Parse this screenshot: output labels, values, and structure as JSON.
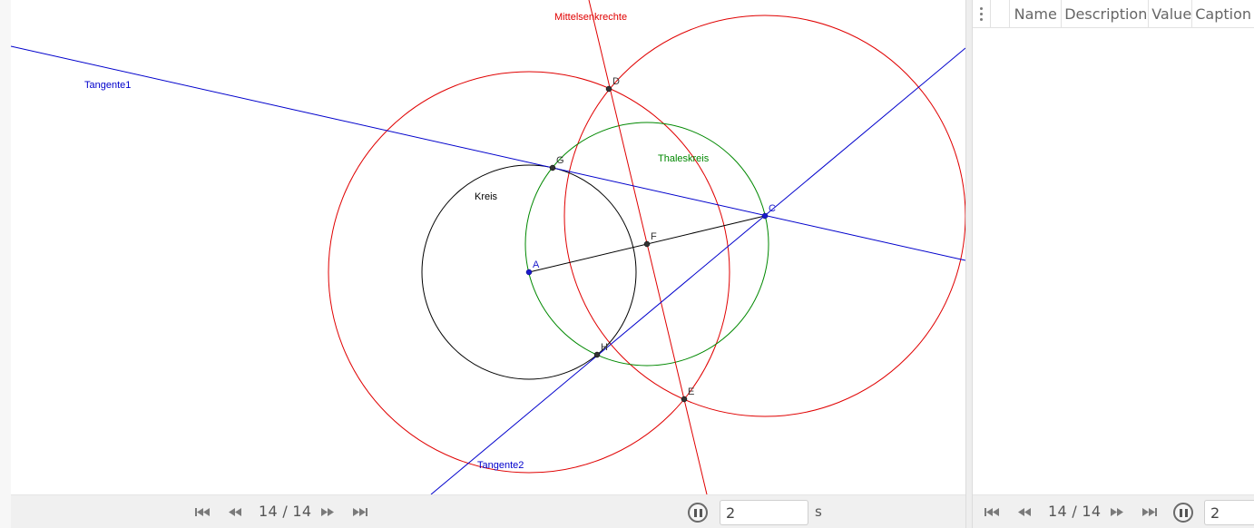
{
  "graphics": {
    "labels": {
      "mittelsenkrechte": "Mittelsenkrechte",
      "tangente1": "Tangente1",
      "tangente2": "Tangente2",
      "thaleskreis": "Thaleskreis",
      "kreis": "Kreis"
    },
    "points": {
      "A": "A",
      "C": "C",
      "D": "D",
      "E": "E",
      "F": "F",
      "G": "G",
      "H": "H"
    },
    "colors": {
      "red": "#e00000",
      "blue": "#0000cc",
      "green": "#008800",
      "black": "#000000"
    }
  },
  "algebra": {
    "columns": [
      "Name",
      "Description",
      "Value",
      "Caption"
    ]
  },
  "toolbar_left": {
    "counter": "14 / 14",
    "speed_value": "2",
    "unit": "s"
  },
  "toolbar_right": {
    "counter": "14 / 14",
    "speed_value": "2"
  }
}
